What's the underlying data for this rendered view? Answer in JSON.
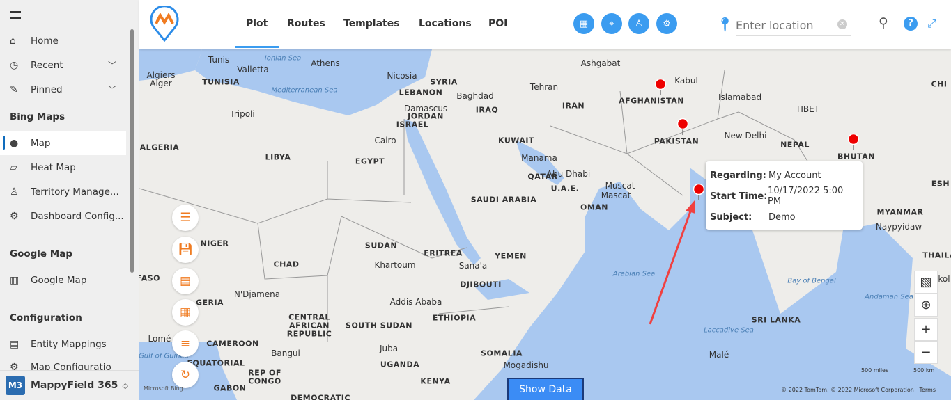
{
  "sidebar": {
    "items": [
      {
        "label": "Home",
        "icon": "home-icon"
      },
      {
        "label": "Recent",
        "icon": "clock-icon"
      },
      {
        "label": "Pinned",
        "icon": "pin-icon"
      }
    ],
    "sections": [
      {
        "title": "Bing Maps",
        "items": [
          {
            "label": "Map",
            "icon": "map-marker-icon",
            "active": true
          },
          {
            "label": "Heat Map",
            "icon": "heat-map-icon"
          },
          {
            "label": "Territory Manage...",
            "icon": "territory-icon"
          },
          {
            "label": "Dashboard Config...",
            "icon": "wrench-gear-icon"
          }
        ]
      },
      {
        "title": "Google Map",
        "items": [
          {
            "label": "Google Map",
            "icon": "map-icon"
          }
        ]
      },
      {
        "title": "Configuration",
        "items": [
          {
            "label": "Entity Mappings",
            "icon": "document-icon"
          },
          {
            "label": "Map Configuratio",
            "icon": "gear-icon"
          }
        ]
      }
    ],
    "footer": {
      "badge": "M3",
      "name": "MappyField 365"
    }
  },
  "header": {
    "tabs": [
      {
        "label": "Plot",
        "active": true
      },
      {
        "label": "Routes"
      },
      {
        "label": "Templates"
      },
      {
        "label": "Locations"
      },
      {
        "label": "POI"
      }
    ],
    "location_placeholder": "Enter location",
    "accent": "#3b9cf0"
  },
  "tooltip": {
    "rows": [
      {
        "k": "Regarding:",
        "v": "My Account"
      },
      {
        "k": "Start Time:",
        "v": "10/17/2022 5:00 PM"
      },
      {
        "k": "Subject:",
        "v": "Demo"
      }
    ]
  },
  "map": {
    "labels": [
      "Tunis",
      "Valletta",
      "Ionian Sea",
      "Athens",
      "Algiers",
      "Alger",
      "TUNISIA",
      "Mediterranean Sea",
      "Nicosia",
      "SYRIA",
      "LEBANON",
      "Baghdad",
      "Damascus",
      "IRAQ",
      "JORDAN",
      "ISRAEL",
      "Tripoli",
      "Ashgabat",
      "Tehran",
      "IRAN",
      "Kabul",
      "AFGHANISTAN",
      "Islamabad",
      "TIBET",
      "CHI",
      "Cairo",
      "ALGERIA",
      "LIBYA",
      "EGYPT",
      "KUWAIT",
      "PAKISTAN",
      "New Delhi",
      "NEPAL",
      "BHUTAN",
      "Manama",
      "Abu Dhabi",
      "QATAR",
      "U.A.E.",
      "Muscat",
      "Mascat",
      "SAUDI ARABIA",
      "OMAN",
      "MYANMAR",
      "Naypyidaw",
      "NIGER",
      "SUDAN",
      "CHAD",
      "Khartoum",
      "ERITREA",
      "Sana'a",
      "YEMEN",
      "Arabian Sea",
      "Bay of Bengal",
      "FASO",
      "N'Djamena",
      "DJIBOUTI",
      "Addis Ababa",
      "GERIA",
      "Andaman Sea",
      "CENTRAL",
      "AFRICAN",
      "REPUBLIC",
      "ETHIOPIA",
      "SOUTH SUDAN",
      "SRI LANKA",
      "Lomé",
      "CAMEROON",
      "Juba",
      "Laccadive Sea",
      "Gulf of Guinea",
      "SOMALIA",
      "Bangui",
      "Malé",
      "UGANDA",
      "EQUATORIAL",
      "Mogadishu",
      "REP OF",
      "CONGO",
      "KENYA",
      "GABON",
      "DEMOCRATIC",
      "ESH",
      "THAILA",
      "kol"
    ],
    "show_data": "Show Data",
    "scale_miles": "500 miles",
    "scale_km": "500 km",
    "copyright": "© 2022 TomTom, © 2022 Microsoft Corporation",
    "terms": "Terms",
    "bing": "Microsoft Bing"
  }
}
